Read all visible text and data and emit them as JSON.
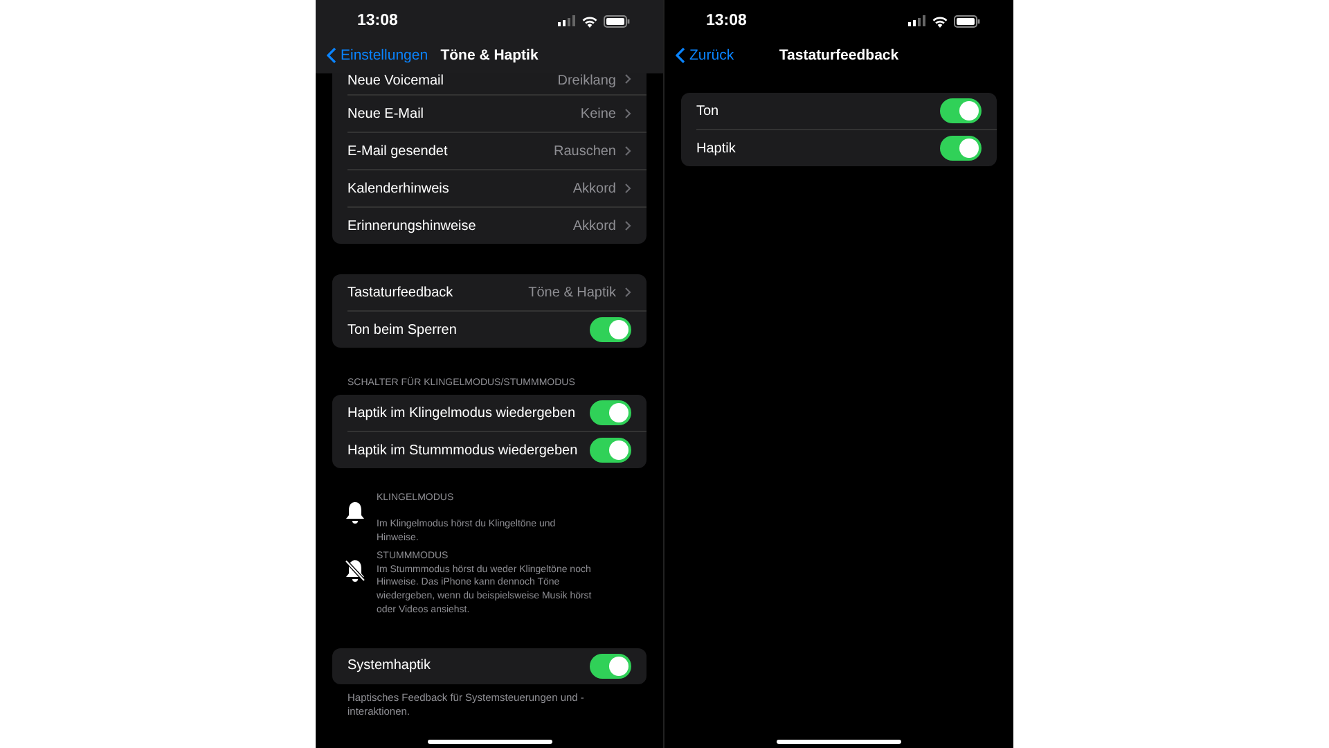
{
  "screens": [
    {
      "status": {
        "time": "13:08"
      },
      "nav": {
        "back": "Einstellungen",
        "title": "Töne & Haptik"
      },
      "sections": [
        {
          "kind": "group",
          "rows": [
            {
              "kind": "link",
              "label": "Neue Voicemail",
              "value": "Dreiklang"
            },
            {
              "kind": "link",
              "label": "Neue E-Mail",
              "value": "Keine"
            },
            {
              "kind": "link",
              "label": "E-Mail gesendet",
              "value": "Rauschen"
            },
            {
              "kind": "link",
              "label": "Kalenderhinweis",
              "value": "Akkord"
            },
            {
              "kind": "link",
              "label": "Erinnerungshinweise",
              "value": "Akkord"
            }
          ]
        },
        {
          "kind": "group",
          "rows": [
            {
              "kind": "link",
              "label": "Tastaturfeedback",
              "value": "Töne & Haptik"
            },
            {
              "kind": "toggle",
              "label": "Ton beim Sperren",
              "on": true
            }
          ]
        },
        {
          "kind": "group",
          "header": "SCHALTER FÜR KLINGELMODUS/STUMMMODUS",
          "rows": [
            {
              "kind": "toggle",
              "label": "Haptik im Klingelmodus wiedergeben",
              "on": true
            },
            {
              "kind": "toggle",
              "label": "Haptik im Stummmodus wiedergeben",
              "on": true
            }
          ]
        },
        {
          "kind": "ring",
          "title": "KLINGELMODUS",
          "text": "Im Klingelmodus hörst du Klingeltöne und Hinweise."
        },
        {
          "kind": "silent",
          "title": "STUMMMODUS",
          "text": "Im Stummmodus hörst du weder Klingeltöne noch Hinweise. Das iPhone kann dennoch Töne wiedergeben, wenn du beispielsweise Musik hörst oder Videos ansiehst."
        },
        {
          "kind": "group",
          "rows": [
            {
              "kind": "toggle",
              "label": "Systemhaptik",
              "on": true
            }
          ],
          "footer": "Haptisches Feedback für Systemsteuerungen und -interaktionen."
        }
      ]
    },
    {
      "status": {
        "time": "13:08"
      },
      "nav": {
        "back": "Zurück",
        "title": "Tastaturfeedback"
      },
      "sections": [
        {
          "kind": "group",
          "rows": [
            {
              "kind": "toggle",
              "label": "Ton",
              "on": true
            },
            {
              "kind": "toggle",
              "label": "Haptik",
              "on": true
            }
          ]
        }
      ]
    }
  ]
}
